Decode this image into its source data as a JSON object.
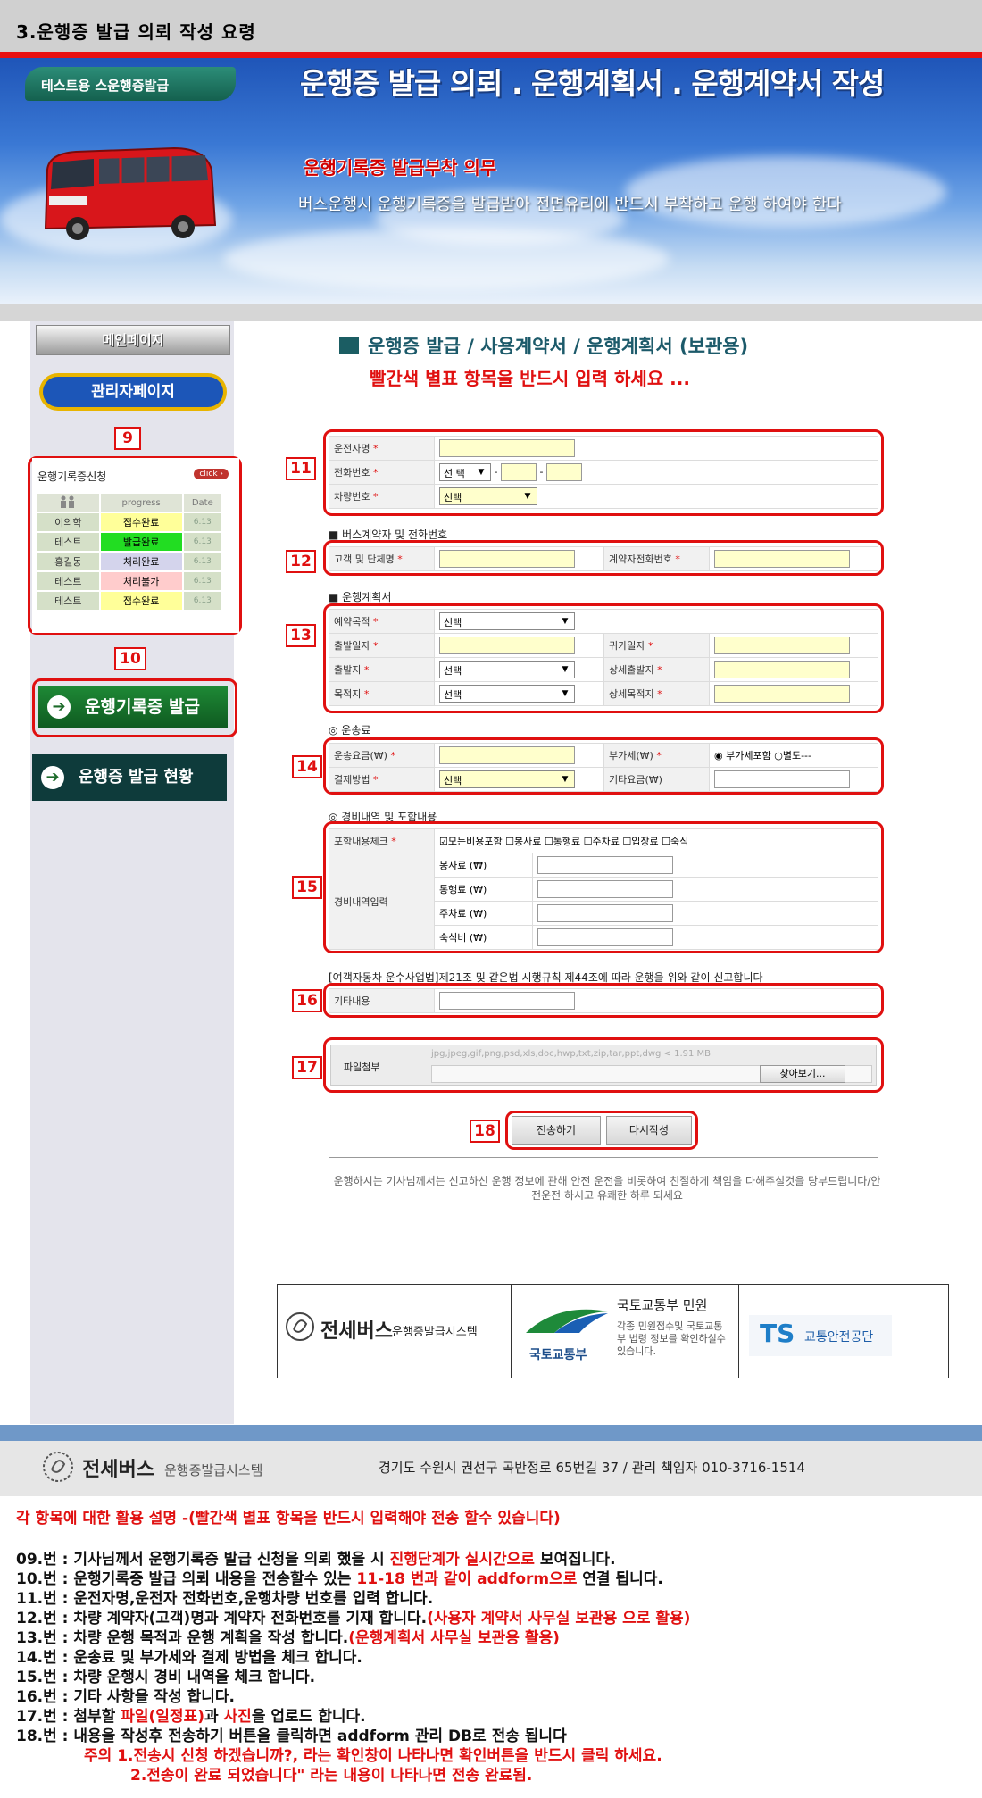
{
  "page": {
    "title": "3.운행증 발급 의뢰 작성 요령"
  },
  "banner": {
    "tag": "테스트용 스운행증발급",
    "title": "운행증 발급 의뢰 . 운행계획서 . 운행계약서 작성",
    "subtitle": "운행기록증 발급부착 의무",
    "desc": "버스운행시 운행기록증을 발급받아 전면유리에 반드시 부착하고   운행 하여야 한다"
  },
  "sidebar": {
    "main_page": "메인페이지",
    "admin_page": "관리자페이지",
    "progress": {
      "title": "운행기록증신청",
      "click": "click ›",
      "headers": [
        "",
        "progress",
        "Date"
      ],
      "rows": [
        {
          "name": "이의학",
          "status": "접수완료",
          "date": "6.13",
          "color": "#ffff99"
        },
        {
          "name": "테스트",
          "status": "발급완료",
          "date": "6.13",
          "color": "#22dd22"
        },
        {
          "name": "홍길동",
          "status": "처리완료",
          "date": "6.13",
          "color": "#d4d4ec"
        },
        {
          "name": "테스트",
          "status": "처리불가",
          "date": "6.13",
          "color": "#ffcccc"
        },
        {
          "name": "테스트",
          "status": "접수완료",
          "date": "6.13",
          "color": "#ffff99"
        }
      ]
    },
    "issue_btn": "운행기록증 발급",
    "status_btn": "운행증 발급 현황"
  },
  "badges": [
    "9",
    "10",
    "11",
    "12",
    "13",
    "14",
    "15",
    "16",
    "17",
    "18"
  ],
  "form": {
    "title": "운행증 발급 / 사용계약서 / 운행계획서 (보관용)",
    "note": "빨간색 별표 항목을 반드시 입력 하세요 ...",
    "driver_name": "운전자명",
    "phone": "전화번호",
    "phone_select": "선 택",
    "dash": "-",
    "vehicle_no": "차량번호",
    "vehicle_select": "선택",
    "sec_contract": "■ 버스계약자 및 전화번호",
    "customer": "고객 및 단체명",
    "contract_phone": "계약자전화번호",
    "sec_plan": "■ 운행계획서",
    "purpose": "예약목적",
    "purpose_select": "선택",
    "depart_date": "출발일자",
    "return_date": "귀가일자",
    "depart": "출발지",
    "depart_select": "선택",
    "depart_detail": "상세출발지",
    "dest": "목적지",
    "dest_select": "선택",
    "dest_detail": "상세목적지",
    "sec_fare": "◎ 운송료",
    "fare": "운송요금(₩)",
    "vat": "부가세(₩)",
    "vat_incl": "부가세포함",
    "vat_sep": "별도---",
    "payment": "결제방법",
    "payment_select": "선택",
    "other_fee": "기타요금(₩)",
    "sec_cost": "◎ 경비내역 및 포함내용",
    "include_check": "포함내용체크",
    "checks": [
      "모든비용포함",
      "봉사료",
      "통행료",
      "주차료",
      "입장료",
      "숙식"
    ],
    "cost_input": "경비내역입력",
    "cost_rows": [
      "봉사료 (₩)",
      "통행료 (₩)",
      "주차료 (₩)",
      "숙식비 (₩)"
    ],
    "legal": "[여객자동차 운수사업법]제21조 및 같은법 시행규칙 제44조에 따라 운행을 위와 같이 신고합니다",
    "other": "기타내용",
    "file": "파일첨부",
    "file_hint": "jpg,jpeg,gif,png,psd,xls,doc,hwp,txt,zip,tar,ppt,dwg < 1.91 MB",
    "browse": "찾아보기...",
    "submit": "전송하기",
    "reset": "다시작성",
    "footer_msg": "운행하시는 기사님께서는 신고하신 운행 정보에 관해 안전 운전을 비롯하여 친절하게 책임을 다해주실것을 당부드립니다/안전운전 하시고 유쾌한 하루 되세요"
  },
  "logos": {
    "jeonse": "전세버스",
    "jeonse_sub": "운행증발급시스템",
    "molit": "국토교통부",
    "molit_title": "국토교통부 민원",
    "molit_desc": "각종 민원접수및 국토교통부 법령 정보를 확인하실수 있습니다.",
    "ts": "TS",
    "ts_sub": "교통안전공단"
  },
  "bottom": {
    "brand": "전세버스",
    "brand_sub": "운행증발급시스템",
    "address": "경기도 수원시 권선구 곡반정로 65번길 37  /  관리 책임자   010-3716-1514"
  },
  "explain": {
    "head_black": "각 항목에 대한 활용 설명 -",
    "head_red": "(빨간색 별표 항목을 반드시 입력해야 전송 할수 있습니다)",
    "l09a": "09.번 : 기사님께서 운행기록증 발급 신청을 의뢰 했을 시 ",
    "l09b": "진행단계가 실시간으로",
    "l09c": "  보여집니다.",
    "l10a": "10.번 : 운행기록증 발급 의뢰 내용을 전송할수 있는 ",
    "l10b": "11-18 번과 같이 addform으로",
    "l10c": " 연결 됩니다.",
    "l11": "11.번 : 운전자명,운전자 전화번호,운행차량 번호를 입력 합니다.",
    "l12a": "12.번 : 차량 계약자(고객)명과 계약자 전화번호를 기재 합니다.",
    "l12b": "(사용자 계약서 사무실 보관용 으로 활용)",
    "l13a": "13.번 : 차량 운행 목적과 운행 계획을 작성 합니다.",
    "l13b": "(운행계획서 사무실 보관용 활용)",
    "l14": "14.번 : 운송료 및 부가세와 결제 방법을 체크 합니다.",
    "l15": "15.번 : 차량 운행시 경비 내역을 체크 합니다.",
    "l16": "16.번 : 기타 사항을 작성 합니다.",
    "l17a": "17.번 : 첨부할 ",
    "l17b": "파일(일정표)",
    "l17c": "과 ",
    "l17d": "사진",
    "l17e": "을 업로드 합니다.",
    "l18": "18.번 : 내용을 작성후 전송하기 버튼을 클릭하면 addform 관리 DB로 전송 됩니다",
    "note1": "주의 1.전송시 신청 하겠습니까?, 라는 확인창이 나타나면 확인버튼을 반드시 클릭 하세요.",
    "note2": "2.전송이 완료 되었습니다\" 라는 내용이 나타나면 전송 완료됨."
  }
}
